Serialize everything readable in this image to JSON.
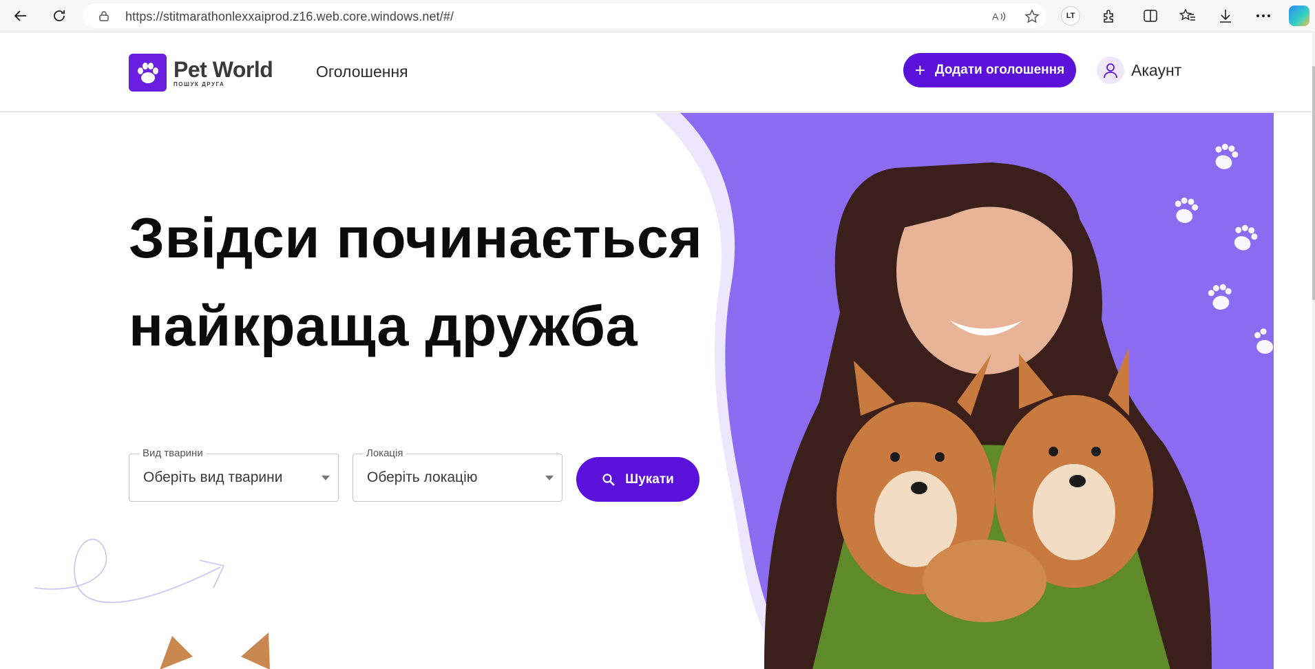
{
  "browser": {
    "url": "https://stitmarathonlexxaiprod.z16.web.core.windows.net/#/",
    "lt_badge": "LT"
  },
  "header": {
    "logo_title": "Pet World",
    "logo_subtitle": "пошук друга",
    "nav_link": "Оголошення",
    "add_button_label": "Додати оголошення",
    "add_button_icon": "+",
    "account_label": "Акаунт"
  },
  "hero": {
    "title_line1": "Звідси починається",
    "title_line2": "найкраща дружба",
    "animal_select": {
      "legend": "Вид тварини",
      "value": "Оберіть вид тварини"
    },
    "location_select": {
      "legend": "Локація",
      "value": "Оберіть локацію"
    },
    "search_button_label": "Шукати"
  },
  "colors": {
    "brand": "#5a11d9",
    "hero_bg": "#8b6cf0"
  }
}
